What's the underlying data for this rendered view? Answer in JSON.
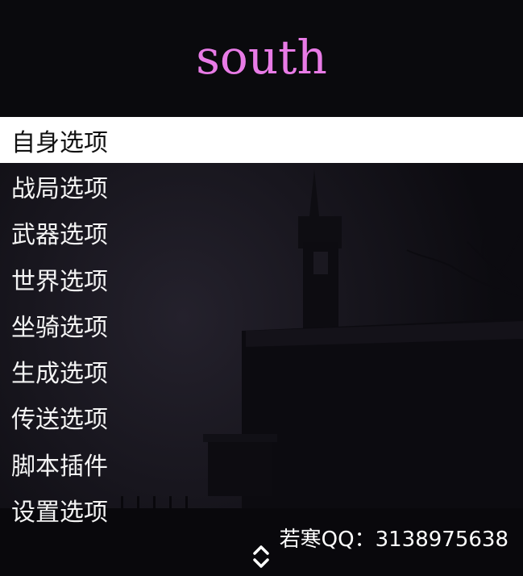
{
  "menu": {
    "title": "south",
    "items": [
      {
        "label": "自身选项",
        "selected": true
      },
      {
        "label": "战局选项",
        "selected": false
      },
      {
        "label": "武器选项",
        "selected": false
      },
      {
        "label": "世界选项",
        "selected": false
      },
      {
        "label": "坐骑选项",
        "selected": false
      },
      {
        "label": "生成选项",
        "selected": false
      },
      {
        "label": "传送选项",
        "selected": false
      },
      {
        "label": "脚本插件",
        "selected": false
      },
      {
        "label": "设置选项",
        "selected": false
      }
    ]
  },
  "footer": {
    "contact": "若寒QQ：3138975638"
  },
  "icons": {
    "scroll": "up-down-chevron-icon"
  },
  "colors": {
    "title": "#e87be6",
    "selected_bg": "#ffffff",
    "selected_text": "#111111",
    "item_text": "#f4f4f4",
    "header_bg": "#0a0a0d"
  }
}
